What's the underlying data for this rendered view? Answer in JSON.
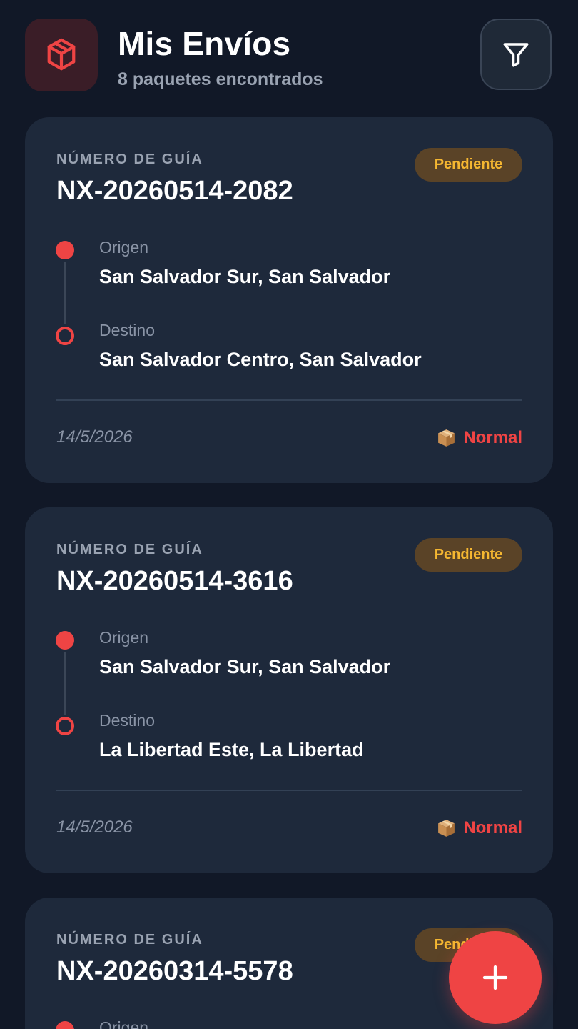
{
  "header": {
    "title": "Mis Envíos",
    "subtitle": "8 paquetes encontrados",
    "logo_icon": "package-icon",
    "filter_icon": "filter-icon"
  },
  "colors": {
    "background": "#111827",
    "card": "#1e293b",
    "accent": "#ef4444",
    "pending_badge_bg": "#5a4327",
    "pending_badge_text": "#f5b731"
  },
  "shipments": [
    {
      "guia_label": "NÚMERO DE GUÍA",
      "guia_number": "NX-20260514-2082",
      "status": "Pendiente",
      "origin_label": "Origen",
      "origin": "San Salvador Sur, San Salvador",
      "destination_label": "Destino",
      "destination": "San Salvador Centro, San Salvador",
      "date": "14/5/2026",
      "priority": "Normal",
      "priority_icon": "package-emoji-icon"
    },
    {
      "guia_label": "NÚMERO DE GUÍA",
      "guia_number": "NX-20260514-3616",
      "status": "Pendiente",
      "origin_label": "Origen",
      "origin": "San Salvador Sur, San Salvador",
      "destination_label": "Destino",
      "destination": "La Libertad Este, La Libertad",
      "date": "14/5/2026",
      "priority": "Normal",
      "priority_icon": "package-emoji-icon"
    },
    {
      "guia_label": "NÚMERO DE GUÍA",
      "guia_number": "NX-20260314-5578",
      "status": "Pendiente",
      "origin_label": "Origen"
    }
  ],
  "fab": {
    "icon": "plus-icon"
  }
}
